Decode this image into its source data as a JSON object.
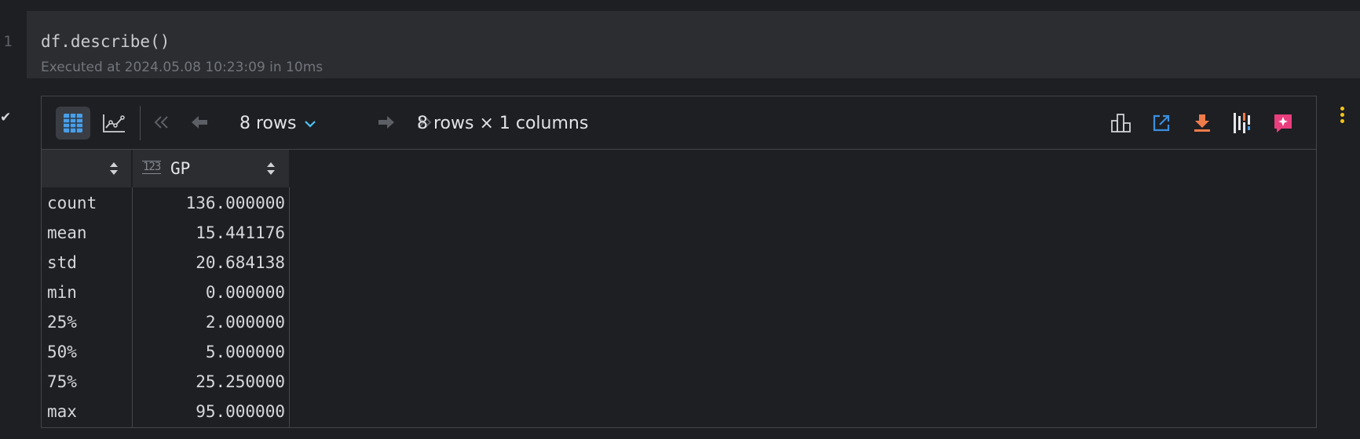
{
  "cell": {
    "line_number": "1",
    "code": "df.describe()",
    "execution_info": "Executed at 2024.05.08 10:23:09 in 10ms",
    "status_icon": "check-icon"
  },
  "toolbar": {
    "rows_label": "8 rows",
    "dims_label": "8 rows × 1 columns",
    "icons": {
      "table_view": "table-icon",
      "chart_view": "chart-line-icon",
      "first_page": "double-chevron-left-icon",
      "prev_page": "arrow-left-icon",
      "next_page": "arrow-right-icon",
      "last_page": "double-chevron-right-icon",
      "column_stats": "bar-columns-icon",
      "open_in_tab": "open-external-icon",
      "download": "download-icon",
      "profile": "profile-bars-icon",
      "ai_assistant": "ai-sparkle-icon"
    },
    "colors": {
      "active_table": "#4a9ee8",
      "open_external": "#3a8fe0",
      "download": "#ef7b4b",
      "ai": "#e93e7d",
      "chevron": "#4fc3f7"
    }
  },
  "table": {
    "index_header": "",
    "columns": [
      {
        "name": "GP",
        "type_badge": "123"
      }
    ],
    "rows": [
      {
        "index": "count",
        "GP": "136.000000"
      },
      {
        "index": "mean",
        "GP": "15.441176"
      },
      {
        "index": "std",
        "GP": "20.684138"
      },
      {
        "index": "min",
        "GP": "0.000000"
      },
      {
        "index": "25%",
        "GP": "2.000000"
      },
      {
        "index": "50%",
        "GP": "5.000000"
      },
      {
        "index": "75%",
        "GP": "25.250000"
      },
      {
        "index": "max",
        "GP": "95.000000"
      }
    ]
  }
}
